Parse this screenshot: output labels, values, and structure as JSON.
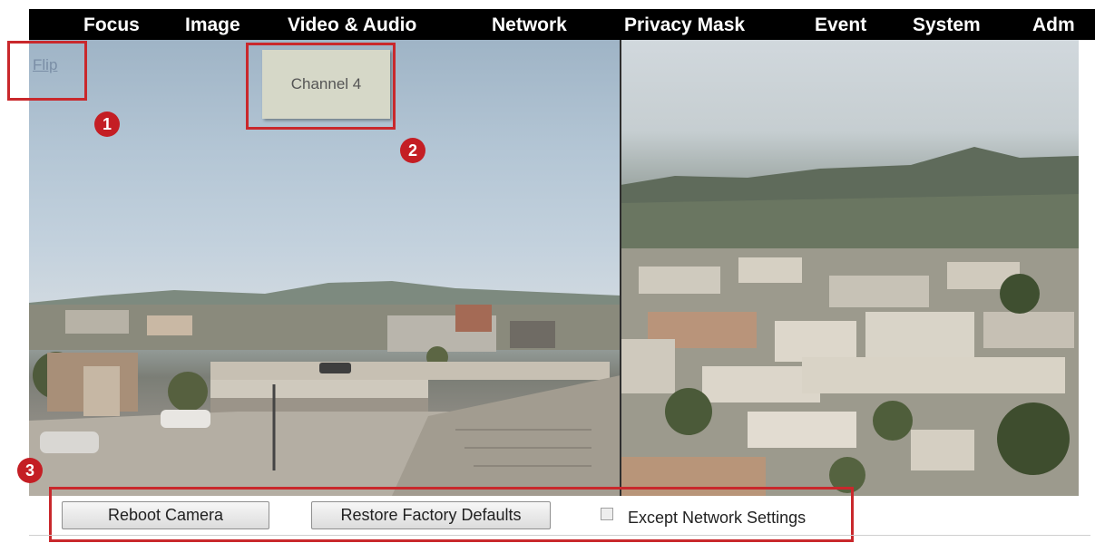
{
  "nav": {
    "items": [
      "Focus",
      "Image",
      "Video & Audio",
      "Network",
      "Privacy Mask",
      "Event",
      "System",
      "Adm"
    ]
  },
  "video": {
    "flip_link": "Flip",
    "channel_label": "Channel 4"
  },
  "callouts": [
    "1",
    "2",
    "3"
  ],
  "controls": {
    "reboot_label": "Reboot Camera",
    "restore_label": "Restore Factory Defaults",
    "except_network_label": "Except Network Settings",
    "except_network_checked": false
  },
  "colors": {
    "nav_bg": "#000000",
    "callout_red": "#c9282c",
    "badge_red": "#c41e24"
  }
}
